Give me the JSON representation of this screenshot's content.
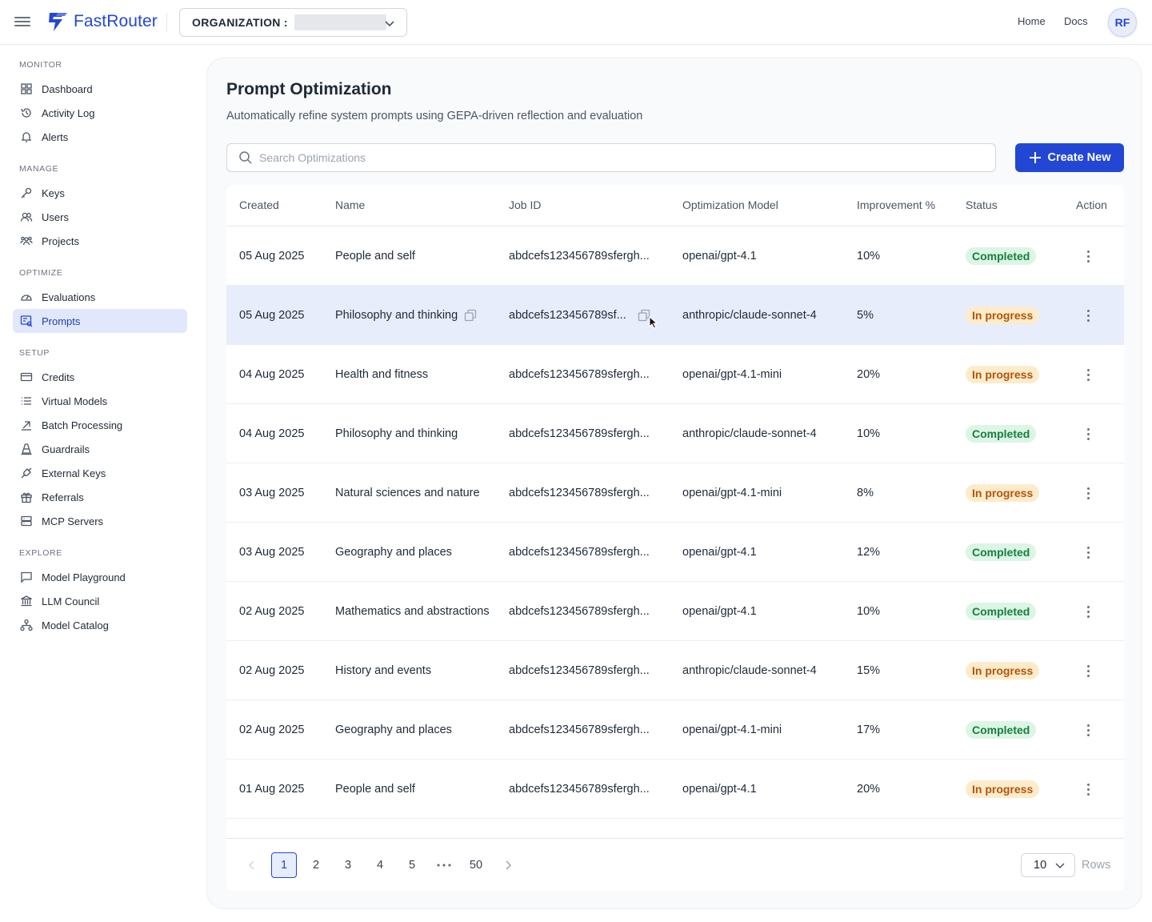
{
  "app": {
    "name": "FastRouter",
    "brand_color": "#2347d5"
  },
  "header": {
    "org_label": "ORGANIZATION :",
    "links": [
      "Home",
      "Docs"
    ],
    "avatar_initials": "RF"
  },
  "sidebar": {
    "sections": [
      {
        "title": "MONITOR",
        "items": [
          {
            "label": "Dashboard",
            "icon": "grid-icon"
          },
          {
            "label": "Activity Log",
            "icon": "history-icon"
          },
          {
            "label": "Alerts",
            "icon": "bell-icon"
          }
        ]
      },
      {
        "title": "MANAGE",
        "items": [
          {
            "label": "Keys",
            "icon": "key-icon"
          },
          {
            "label": "Users",
            "icon": "users-icon"
          },
          {
            "label": "Projects",
            "icon": "team-icon"
          }
        ]
      },
      {
        "title": "OPTIMIZE",
        "items": [
          {
            "label": "Evaluations",
            "icon": "gauge-icon"
          },
          {
            "label": "Prompts",
            "icon": "prompt-icon",
            "active": true
          }
        ]
      },
      {
        "title": "SETUP",
        "items": [
          {
            "label": "Credits",
            "icon": "card-icon"
          },
          {
            "label": "Virtual Models",
            "icon": "list-icon"
          },
          {
            "label": "Batch Processing",
            "icon": "arrow-up-right-icon"
          },
          {
            "label": "Guardrails",
            "icon": "cone-icon"
          },
          {
            "label": "External Keys",
            "icon": "plug-icon"
          },
          {
            "label": "Referrals",
            "icon": "gift-icon"
          },
          {
            "label": "MCP Servers",
            "icon": "server-icon"
          }
        ]
      },
      {
        "title": "EXPLORE",
        "items": [
          {
            "label": "Model Playground",
            "icon": "chat-icon"
          },
          {
            "label": "LLM Council",
            "icon": "bank-icon"
          },
          {
            "label": "Model Catalog",
            "icon": "network-icon"
          }
        ]
      }
    ]
  },
  "main": {
    "title": "Prompt Optimization",
    "subtitle": "Automatically refine system prompts using GEPA-driven reflection and evaluation",
    "search_placeholder": "Search Optimizations",
    "create_label": "Create New",
    "columns": [
      "Created",
      "Name",
      "Job ID",
      "Optimization Model",
      "Improvement %",
      "Status",
      "Action"
    ],
    "rows": [
      {
        "created": "05 Aug 2025",
        "name": "People and self",
        "job_id": "abdcefs123456789sfergh...",
        "model": "openai/gpt-4.1",
        "improvement": "10%",
        "status": "Completed"
      },
      {
        "created": "05 Aug 2025",
        "name": "Philosophy and thinking",
        "job_id": "abdcefs123456789sf...",
        "model": "anthropic/claude-sonnet-4",
        "improvement": "5%",
        "status": "In progress",
        "highlighted": true
      },
      {
        "created": "04 Aug 2025",
        "name": "Health and fitness",
        "job_id": "abdcefs123456789sfergh...",
        "model": "openai/gpt-4.1-mini",
        "improvement": "20%",
        "status": "In progress"
      },
      {
        "created": "04 Aug 2025",
        "name": "Philosophy and thinking",
        "job_id": "abdcefs123456789sfergh...",
        "model": "anthropic/claude-sonnet-4",
        "improvement": "10%",
        "status": "Completed"
      },
      {
        "created": "03 Aug 2025",
        "name": "Natural sciences and nature",
        "job_id": "abdcefs123456789sfergh...",
        "model": "openai/gpt-4.1-mini",
        "improvement": "8%",
        "status": "In progress"
      },
      {
        "created": "03 Aug 2025",
        "name": "Geography and places",
        "job_id": "abdcefs123456789sfergh...",
        "model": "openai/gpt-4.1",
        "improvement": "12%",
        "status": "Completed"
      },
      {
        "created": "02 Aug 2025",
        "name": "Mathematics and abstractions",
        "job_id": "abdcefs123456789sfergh...",
        "model": "openai/gpt-4.1",
        "improvement": "10%",
        "status": "Completed"
      },
      {
        "created": "02 Aug 2025",
        "name": "History and events",
        "job_id": "abdcefs123456789sfergh...",
        "model": "anthropic/claude-sonnet-4",
        "improvement": "15%",
        "status": "In progress"
      },
      {
        "created": "02 Aug 2025",
        "name": "Geography and places",
        "job_id": "abdcefs123456789sfergh...",
        "model": "openai/gpt-4.1-mini",
        "improvement": "17%",
        "status": "Completed"
      },
      {
        "created": "01 Aug 2025",
        "name": "People and self",
        "job_id": "abdcefs123456789sfergh...",
        "model": "openai/gpt-4.1",
        "improvement": "20%",
        "status": "In progress"
      }
    ],
    "pagination": {
      "pages": [
        "1",
        "2",
        "3",
        "4",
        "5",
        "50"
      ],
      "current": "1",
      "rows_per_page": "10",
      "rows_label": "Rows"
    }
  }
}
